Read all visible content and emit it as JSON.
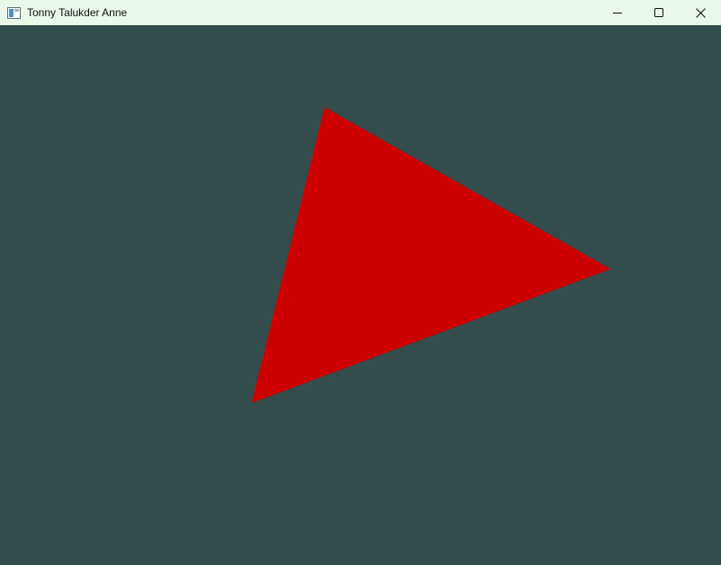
{
  "window": {
    "title": "Tonny Talukder Anne",
    "icon": "app-window-icon",
    "controls": {
      "minimize_icon": "minimize-icon",
      "maximize_icon": "maximize-icon",
      "close_icon": "close-icon"
    }
  },
  "colors": {
    "titlebar_bg": "#eaf8ea",
    "clear_color": "#334d4d",
    "triangle_fill": "#cc0000"
  },
  "scene": {
    "shape": "triangle"
  }
}
